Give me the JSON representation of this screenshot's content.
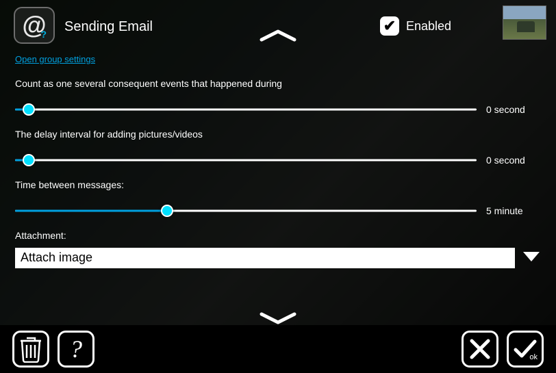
{
  "header": {
    "title": "Sending Email",
    "enabled_label": "Enabled",
    "enabled_checked": true,
    "group_link": "Open group settings"
  },
  "sliders": [
    {
      "label": "Count as one several consequent events that happened during",
      "value_text": "0 second",
      "pos_percent": 3
    },
    {
      "label": "The delay interval for adding pictures/videos",
      "value_text": "0 second",
      "pos_percent": 3
    },
    {
      "label": "Time between messages:",
      "value_text": "5 minute",
      "pos_percent": 33
    }
  ],
  "attachment": {
    "label": "Attachment:",
    "value": "Attach image"
  },
  "footer": {
    "ok_suffix": "ok"
  },
  "colors": {
    "accent": "#00a0df",
    "knob": "#00e0ff"
  }
}
